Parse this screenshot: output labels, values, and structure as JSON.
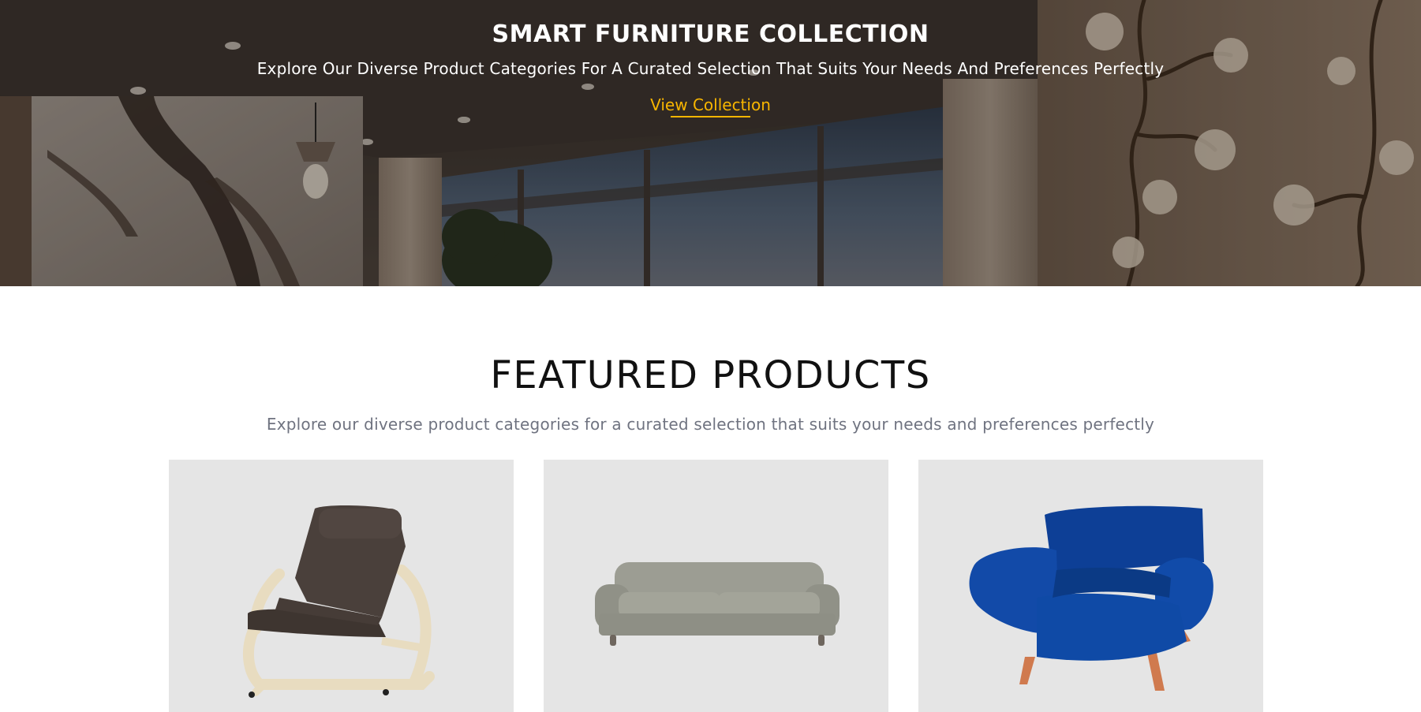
{
  "hero": {
    "title": "SMART FURNITURE COLLECTION",
    "subtitle": "Explore Our Diverse Product Categories For A Curated Selection That Suits Your Needs And Preferences Perfectly",
    "cta_label": "View Collection",
    "accent_color": "#f7b500"
  },
  "featured": {
    "title": "FEATURED PRODUCTS",
    "subtitle": "Explore our diverse product categories for a curated selection that suits your needs and preferences perfectly",
    "products": [
      {
        "image": "armchair-rocking-brown-leather-icon"
      },
      {
        "image": "sofa-gray-three-seat-icon"
      },
      {
        "image": "armchair-blue-velvet-icon"
      }
    ]
  }
}
